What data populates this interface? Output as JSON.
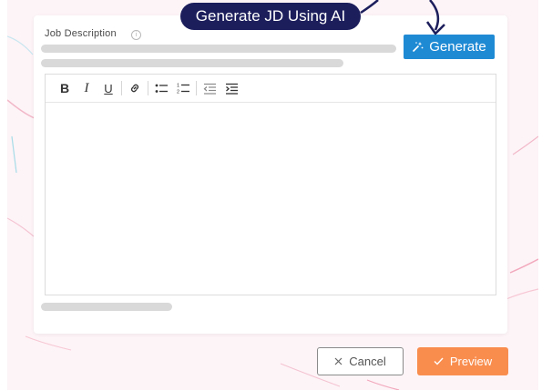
{
  "callout": {
    "text": "Generate JD Using AI"
  },
  "job_description": {
    "label": "Job Description",
    "info_icon": "info-icon",
    "generate_button": {
      "icon": "magic-wand-icon",
      "label": "Generate"
    }
  },
  "editor": {
    "toolbar": [
      {
        "name": "bold-button",
        "glyph": "B"
      },
      {
        "name": "italic-button",
        "glyph": "I"
      },
      {
        "name": "underline-button",
        "glyph": "U"
      },
      {
        "name": "link-button",
        "icon": "link-icon"
      },
      {
        "name": "bullet-list-button",
        "icon": "bullet-list-icon"
      },
      {
        "name": "numbered-list-button",
        "icon": "numbered-list-icon"
      },
      {
        "name": "outdent-button",
        "icon": "outdent-icon"
      },
      {
        "name": "indent-button",
        "icon": "indent-icon"
      }
    ],
    "content": ""
  },
  "footer": {
    "cancel_label": "Cancel",
    "cancel_icon": "close-icon",
    "preview_label": "Preview",
    "preview_icon": "check-icon"
  },
  "colors": {
    "primary_blue": "#1f8ad4",
    "callout_navy": "#1c1e5c",
    "preview_orange": "#f98d4e",
    "skeleton_gray": "#d9d9d9"
  }
}
